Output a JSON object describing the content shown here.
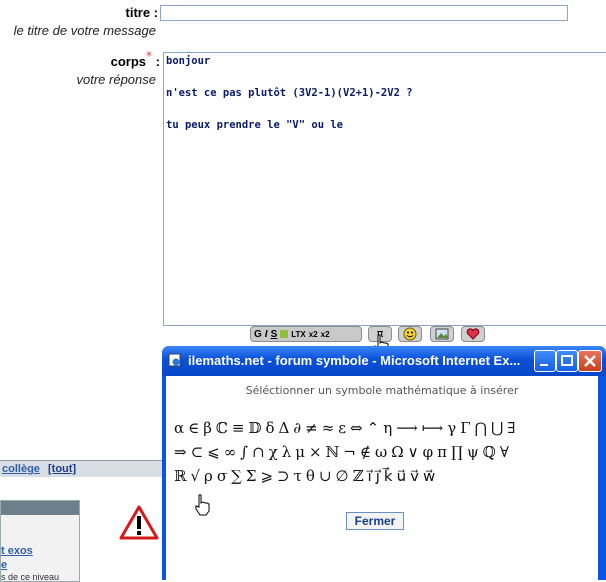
{
  "form": {
    "title_label": "titre :",
    "title_hint": "le titre de votre message",
    "title_value": "",
    "body_label": "corps",
    "body_required_mark": "*",
    "body_colon": ":",
    "body_hint": "votre réponse",
    "body_lines": [
      "bonjour",
      "",
      "n'est ce pas plutôt (3V2-1)(V2+1)-2V2 ?",
      "",
      "tu peux prendre le \"V\" ou le"
    ]
  },
  "toolbar": {
    "format_items": [
      "G",
      "I",
      "S",
      "LTX",
      "x2",
      "x2"
    ],
    "pi_button": "π"
  },
  "background_page": {
    "college_link": "collège",
    "tout_link": "[tout]",
    "exos_link": "t exos",
    "e_link": "e",
    "snippet": "s de ce niveau"
  },
  "popup": {
    "title": "ilemaths.net - forum symbole - Microsoft Internet Ex...",
    "prompt": "Séléctionner un symbole mathématique à insérer",
    "symbols_row1": [
      "α",
      "∈",
      "β",
      "ℂ",
      "≡",
      "𝔻",
      "δ",
      "Δ",
      "∂",
      "≠",
      "≈",
      "ε",
      "⇔",
      "⌃",
      "η",
      "⟶",
      "⟼",
      "γ",
      "Γ",
      "⋂",
      "⋃",
      "∃"
    ],
    "symbols_row2": [
      "⇒",
      "⊂",
      "⩽",
      "∞",
      "∫",
      "∩",
      "χ",
      "λ",
      "μ",
      "×",
      "ℕ",
      "¬",
      "∉",
      "ω",
      "Ω",
      "∨",
      "φ",
      "π",
      "∏",
      "ψ",
      "ℚ",
      "∀"
    ],
    "symbols_row3": [
      "ℝ",
      "√",
      "ρ",
      "σ",
      "∑",
      "Σ",
      "⩾",
      "⊃",
      "τ",
      "θ",
      "∪",
      "∅",
      "ℤ",
      "i⃗",
      "j⃗",
      "k⃗",
      "u⃗",
      "v⃗",
      "w⃗"
    ],
    "close_label": "Fermer"
  },
  "colors": {
    "titlebar": "#0a54e3",
    "text_body": "#0a1a6a",
    "link": "#2d5fa6"
  }
}
